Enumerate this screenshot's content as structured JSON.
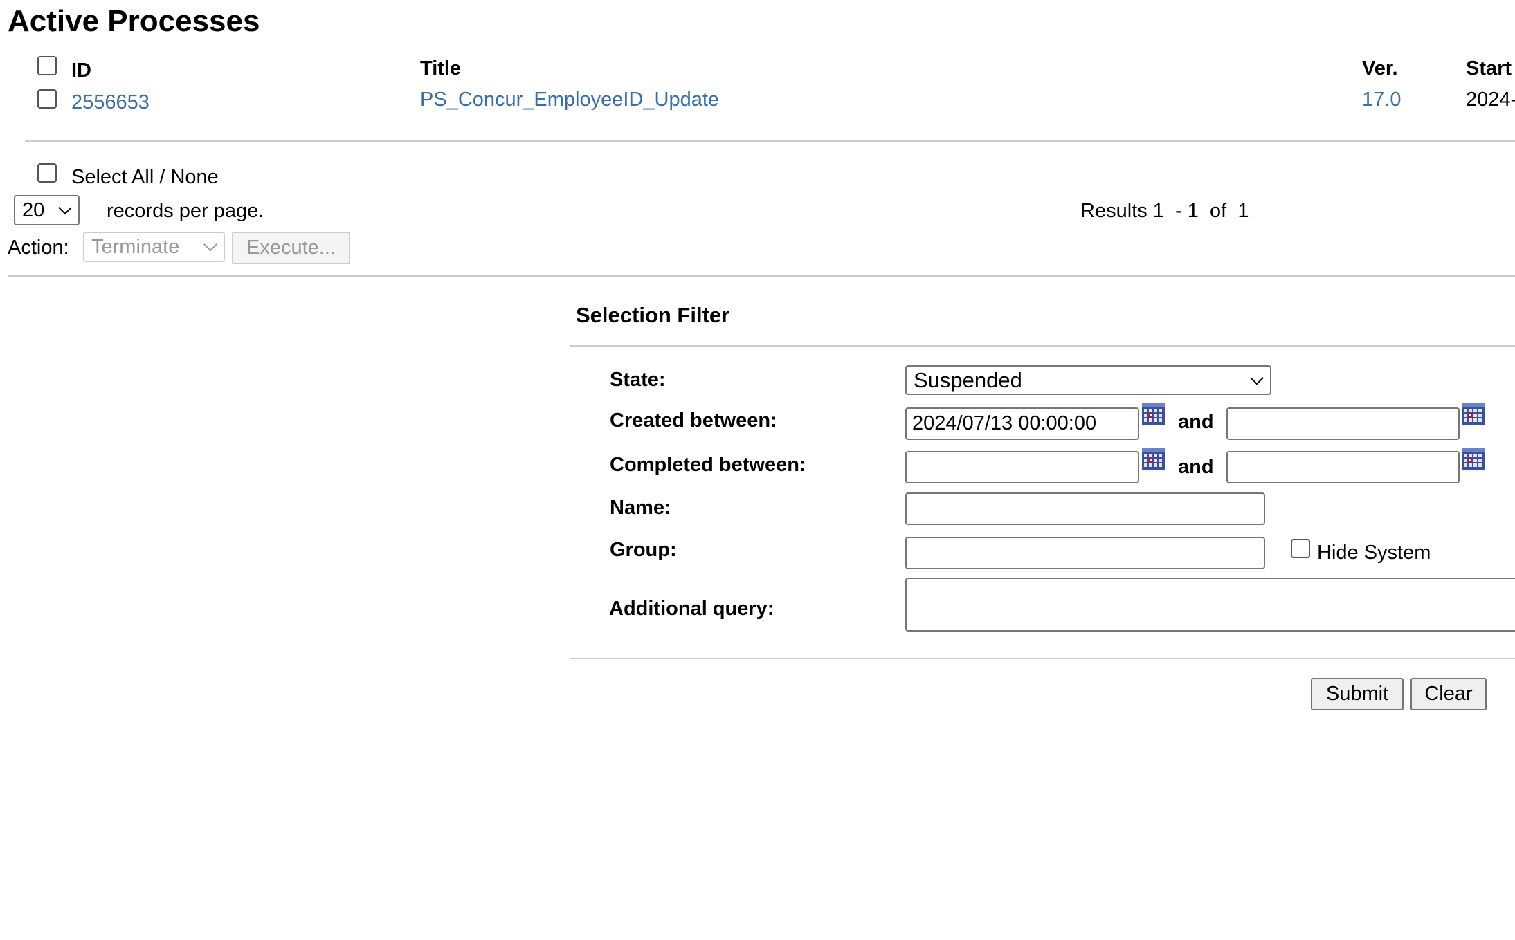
{
  "page_title": "Active Processes",
  "table": {
    "headers": {
      "id": "ID",
      "title": "Title",
      "version": "Ver.",
      "start": "Start"
    },
    "rows": [
      {
        "id": "2556653",
        "title": "PS_Concur_EmployeeID_Update",
        "version": "17.0",
        "start": "2024-"
      }
    ]
  },
  "select_all_label": "Select All / None",
  "records_per_page": {
    "value": "20",
    "label": "records per page."
  },
  "results": {
    "prefix": "Results",
    "from": "1",
    "sep": "- 1",
    "of": "of",
    "total": "1"
  },
  "action": {
    "label": "Action:",
    "selected": "Terminate",
    "execute_label": "Execute..."
  },
  "filter": {
    "title": "Selection Filter",
    "state_label": "State:",
    "state_value": "Suspended",
    "created_label": "Created between:",
    "created_from": "2024/07/13 00:00:00",
    "created_to": "",
    "and_label": "and",
    "completed_label": "Completed between:",
    "completed_from": "",
    "completed_to": "",
    "name_label": "Name:",
    "name_value": "",
    "group_label": "Group:",
    "group_value": "",
    "hide_system_label": "Hide System",
    "additional_label": "Additional query:",
    "additional_value": "",
    "submit_label": "Submit",
    "clear_label": "Clear"
  },
  "icons": {
    "calendar": "calendar-icon"
  },
  "colors": {
    "link": "#3a6ea5"
  }
}
